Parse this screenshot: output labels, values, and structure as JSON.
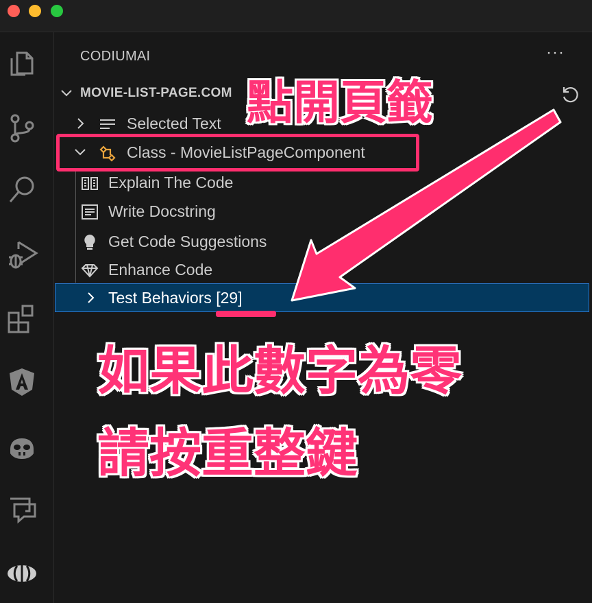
{
  "window": {
    "controls": [
      "close",
      "minimize",
      "maximize"
    ]
  },
  "activity_bar": {
    "icons": [
      "explorer-icon",
      "source-control-icon",
      "search-icon",
      "run-debug-icon",
      "extensions-icon",
      "angular-icon",
      "github-copilot-icon",
      "chat-icon",
      "codiumai-icon"
    ]
  },
  "panel": {
    "title": "CODIUMAI",
    "more_label": "···",
    "file_header": "MOVIE-LIST-PAGE.COM",
    "items": [
      {
        "label": "Selected Text"
      },
      {
        "label": "Class - MovieListPageComponent"
      },
      {
        "label": "Explain The Code"
      },
      {
        "label": "Write Docstring"
      },
      {
        "label": "Get Code Suggestions"
      },
      {
        "label": "Enhance Code"
      },
      {
        "label": "Test Behaviors [29]"
      }
    ]
  },
  "annotations": {
    "open_tab": "點開頁籤",
    "if_zero": "如果此數字為零",
    "press_refresh": "請按重整鍵"
  },
  "colors": {
    "accent": "#ff2e6e",
    "selection": "#04395e",
    "class_icon": "#e8a33d"
  }
}
